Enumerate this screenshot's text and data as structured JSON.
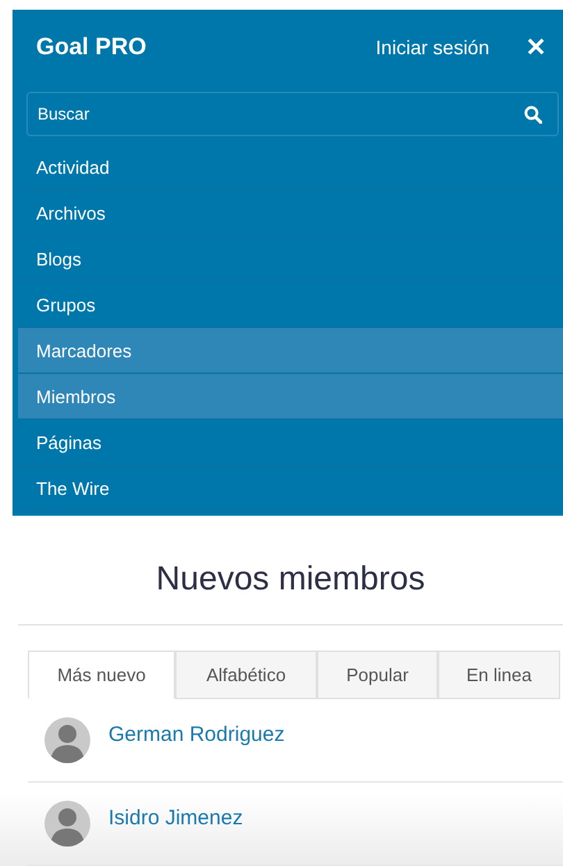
{
  "header": {
    "title": "Goal PRO",
    "login": "Iniciar sesión",
    "close": "✕"
  },
  "search": {
    "placeholder": "Buscar"
  },
  "menu": [
    {
      "label": "Actividad",
      "selected": false
    },
    {
      "label": "Archivos",
      "selected": false
    },
    {
      "label": "Blogs",
      "selected": false
    },
    {
      "label": "Grupos",
      "selected": false
    },
    {
      "label": "Marcadores",
      "selected": true
    },
    {
      "label": "Miembros",
      "selected": true
    },
    {
      "label": "Páginas",
      "selected": false
    },
    {
      "label": "The Wire",
      "selected": false
    }
  ],
  "section_title": "Nuevos miembros",
  "tabs": [
    {
      "label": "Más nuevo",
      "selected": true
    },
    {
      "label": "Alfabético",
      "selected": false
    },
    {
      "label": "Popular",
      "selected": false
    },
    {
      "label": "En linea",
      "selected": false
    }
  ],
  "members": [
    {
      "name": "German Rodriguez"
    },
    {
      "name": "Isidro Jimenez"
    }
  ]
}
